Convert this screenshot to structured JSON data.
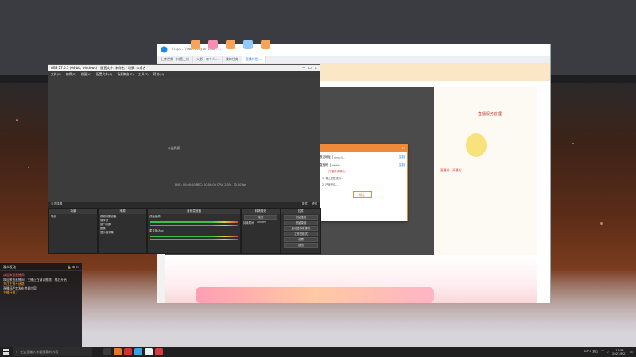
{
  "browser": {
    "address": "https://www.douyin.com/...",
    "tabs": [
      "上传视频 - 抖音上线",
      "火影 - 每个人...",
      "我的任务",
      "直播伴侣..."
    ],
    "right_title": "直播服务管理"
  },
  "dialog": {
    "title": "",
    "rows": [
      {
        "label": "推流地址",
        "value": "rtmp://...",
        "action": "复制"
      },
      {
        "label": "直播码",
        "value": "*******",
        "action": "复制"
      }
    ],
    "warning": "开播前请确认...",
    "notes": [
      "1. 将上述推流码...",
      "2. 已经完成..."
    ],
    "confirm": "确定"
  },
  "right_panel": {
    "tip": "直播间...开播后..."
  },
  "obs": {
    "title": "OBS 27.0.1 (64-bit, windows) - 配置文件: 未命名 - 场景: 未命名",
    "menu": [
      "文件(F)",
      "编辑(E)",
      "视图(V)",
      "配置文件(P)",
      "场景集合(S)",
      "工具(T)",
      "帮助(H)"
    ],
    "no_source": "未选择源",
    "props": "属性",
    "filters": "滤镜",
    "docks": {
      "scenes": {
        "title": "场景",
        "items": [
          "场景"
        ]
      },
      "sources": {
        "title": "来源",
        "items": [
          "视频采集设备",
          "媒体源",
          "窗口采集",
          "图像",
          "显示器采集"
        ]
      },
      "mixer": {
        "title": "音频混音器",
        "channels": [
          "桌面音频",
          "麦克风/Aux"
        ]
      },
      "transitions": {
        "title": "转场特效",
        "fade": "渐变",
        "duration": "持续时间",
        "ms": "300 ms"
      },
      "controls": {
        "title": "控件",
        "buttons": [
          "开始推流",
          "开始录制",
          "启动虚拟摄像机",
          "工作室模式",
          "设置",
          "退出"
        ]
      }
    },
    "status": "LIVE: 00:00:00   REC: 00:00:00   CPU: 2.5%, 30.00 fps"
  },
  "chat": {
    "title": "观众互动",
    "lines": [
      {
        "text": "欢迎来到直播间",
        "cls": "red"
      },
      {
        "text": "欢迎来到直播间！主播正在调试推流，稍后开始",
        "cls": ""
      },
      {
        "text": "关注主播不迷路",
        "cls": "hl"
      },
      {
        "text": "直播间严禁发布违规内容",
        "cls": ""
      },
      {
        "text": "主播开播了",
        "cls": "hl"
      }
    ]
  },
  "taskbar": {
    "search": "在这里输入你要搜索的内容",
    "weather": "28°C 多云",
    "time": "11:56",
    "date": "2021/8/21"
  }
}
